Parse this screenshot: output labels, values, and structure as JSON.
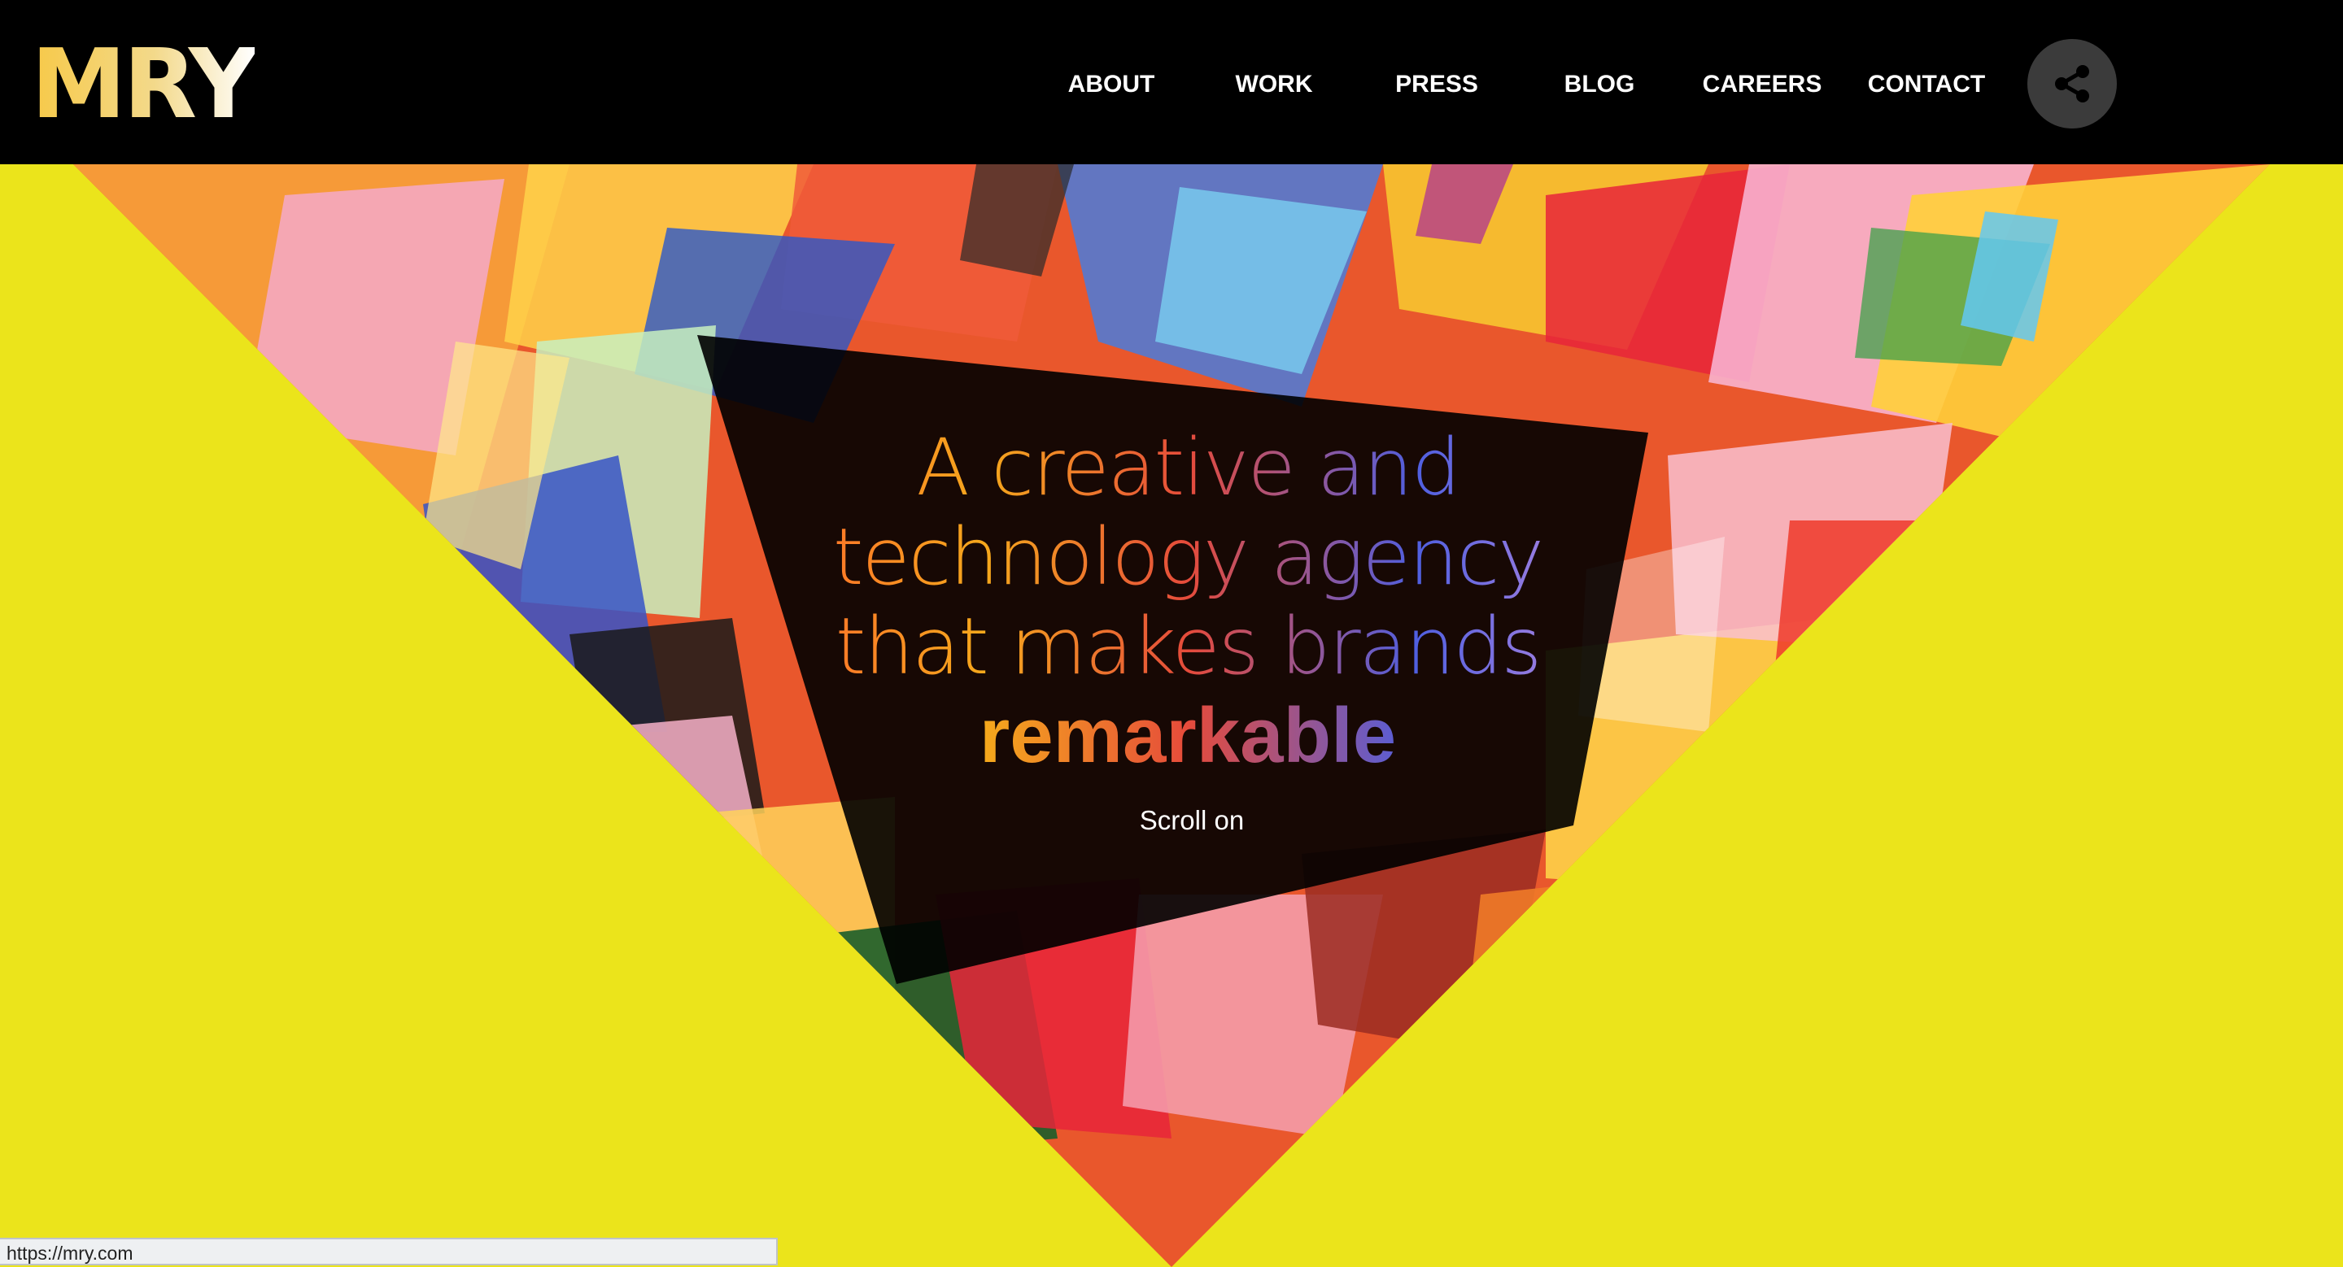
{
  "header": {
    "logo_text": "MRY",
    "nav": [
      {
        "label": "ABOUT"
      },
      {
        "label": "WORK"
      },
      {
        "label": "PRESS"
      },
      {
        "label": "BLOG"
      },
      {
        "label": "CAREERS"
      },
      {
        "label": "CONTACT"
      }
    ],
    "share_icon": "share-icon"
  },
  "hero": {
    "tagline_lines": [
      "A creative and",
      "technology agency",
      "that makes brands",
      "remarkable"
    ],
    "scroll_label": "Scroll on",
    "scroll_icon": "chevron-down-icon",
    "background_color": "#ebe41b"
  },
  "status_bar": {
    "url": "https://mry.com"
  }
}
